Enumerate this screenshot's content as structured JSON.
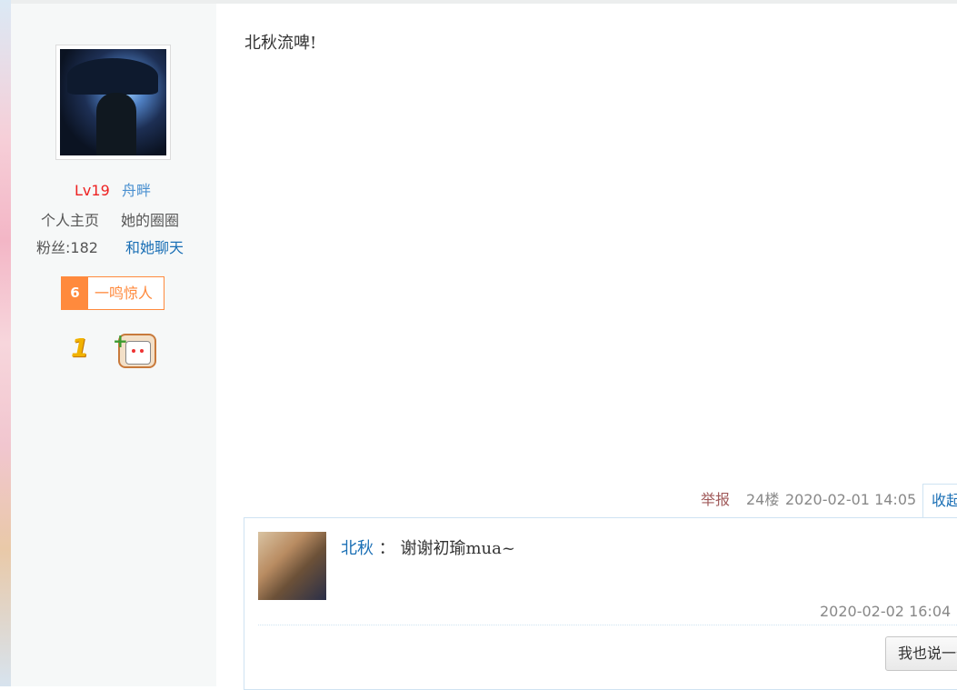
{
  "user": {
    "level": "Lv19",
    "name": "舟畔",
    "home_link": "个人主页",
    "circle_link": "她的圈圈",
    "fans": "粉丝:182",
    "chat_link": "和她聊天",
    "badge_number": "6",
    "badge_text": "一鸣惊人",
    "medal_1": "1"
  },
  "post": {
    "content": "北秋流啤!",
    "report": "举报",
    "floor": "24楼",
    "time": "2020-02-01 14:05",
    "collapse": "收起"
  },
  "reply": {
    "user": "北秋",
    "separator": "：",
    "content": "谢谢初瑜mua~",
    "time": "2020-02-02 16:04",
    "say_button": "我也说一句"
  }
}
